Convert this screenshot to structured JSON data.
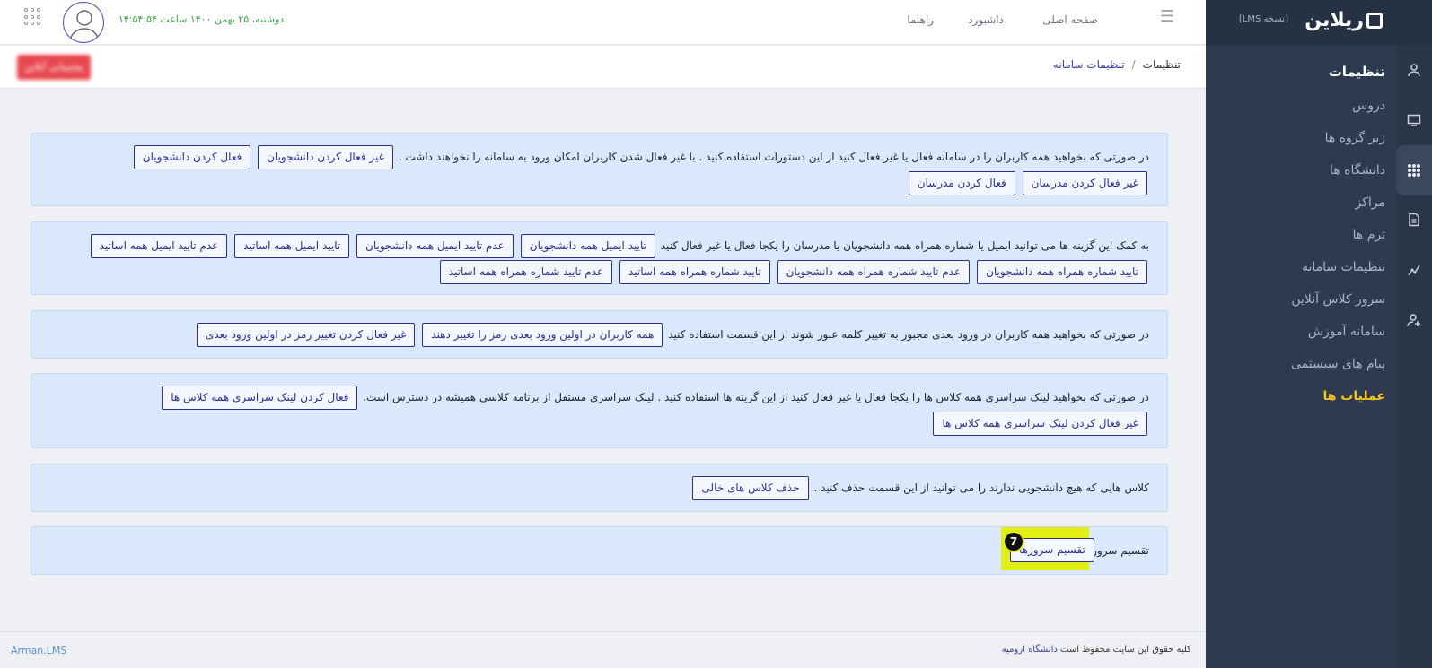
{
  "brand": {
    "logo_text": "ریلاین",
    "version": "[نسخه LMS]"
  },
  "header": {
    "nav": [
      "صفحه اصلی",
      "داشبورد",
      "راهنما"
    ],
    "datetime": "دوشنبه، ۲۵ بهمن ۱۴۰۰ ساعت ۱۴:۵۴:۵۴"
  },
  "breadcrumb": {
    "root": "تنظیمات",
    "separator": "/",
    "current": "تنظیمات سامانه"
  },
  "online_button": "پشتیبانی آنلاین",
  "sidebar": {
    "title": "تنظیمات",
    "items": [
      "دروس",
      "زیر گروه ها",
      "دانشگاه ها",
      "مراکز",
      "ترم ها",
      "تنظیمات سامانه",
      "سرور کلاس آنلاین",
      "سامانه آموزش",
      "پیام های سیستمی",
      "عملیات ها"
    ],
    "active": "عملیات ها"
  },
  "panels": [
    {
      "text": "در صورتی که بخواهید همه کاربران را در سامانه فعال یا غیر فعال کنید از این دستورات استفاده کنید . با غیر فعال شدن کاربران امکان ورود به سامانه را نخواهند داشت .",
      "buttons": [
        "غیر فعال کردن دانشجویان",
        "فعال کردن دانشجویان",
        "غیر فعال کردن مدرسان",
        "فعال کردن مدرسان"
      ]
    },
    {
      "text": "به کمک این گزینه ها می توانید ایمیل یا شماره همراه همه دانشجویان یا مدرسان را یکجا فعال یا غیر فعال کنید",
      "buttons": [
        "تایید ایمیل همه دانشجویان",
        "عدم تایید ایمیل همه دانشجویان",
        "تایید ایمیل همه اساتید",
        "عدم تایید ایمیل همه اساتید",
        "تایید شماره همراه همه دانشجویان",
        "عدم تایید شماره همراه همه دانشجویان",
        "تایید شماره همراه همه اساتید",
        "عدم تایید شماره همراه همه اساتید"
      ]
    },
    {
      "text": "در صورتی که بخواهید همه کاربران در ورود بعدی مجبور به تغییر کلمه عبور شوند از این قسمت استفاده کنید",
      "buttons": [
        "همه کاربران در اولین ورود بعدی رمز را تغییر دهند",
        "غیر فعال کردن تغییر رمز در اولین ورود بعدی"
      ]
    },
    {
      "text": "در صورتی که بخواهید لینک سراسری همه کلاس ها را یکجا فعال یا غیر فعال کنید از این گزینه ها استفاده کنید . لینک سراسری مستقل از برنامه کلاسی همیشه در دسترس است.",
      "buttons": [
        "فعال کردن لینک سراسری همه کلاس ها",
        "غیر فعال کردن لینک سراسری همه کلاس ها"
      ]
    },
    {
      "text": "کلاس هایی که هیچ دانشجویی ندارند را می توانید از این قسمت حذف کنید .",
      "buttons": [
        "حذف کلاس های خالی"
      ]
    },
    {
      "text": "تقسیم سرورها",
      "buttons": [
        "تقسیم سرورها"
      ]
    }
  ],
  "badge": "7",
  "footer": {
    "copyright": "کلیه حقوق این سایت محفوظ است",
    "org": "دانشگاه ارومیه",
    "brand": "Arman.LMS"
  }
}
